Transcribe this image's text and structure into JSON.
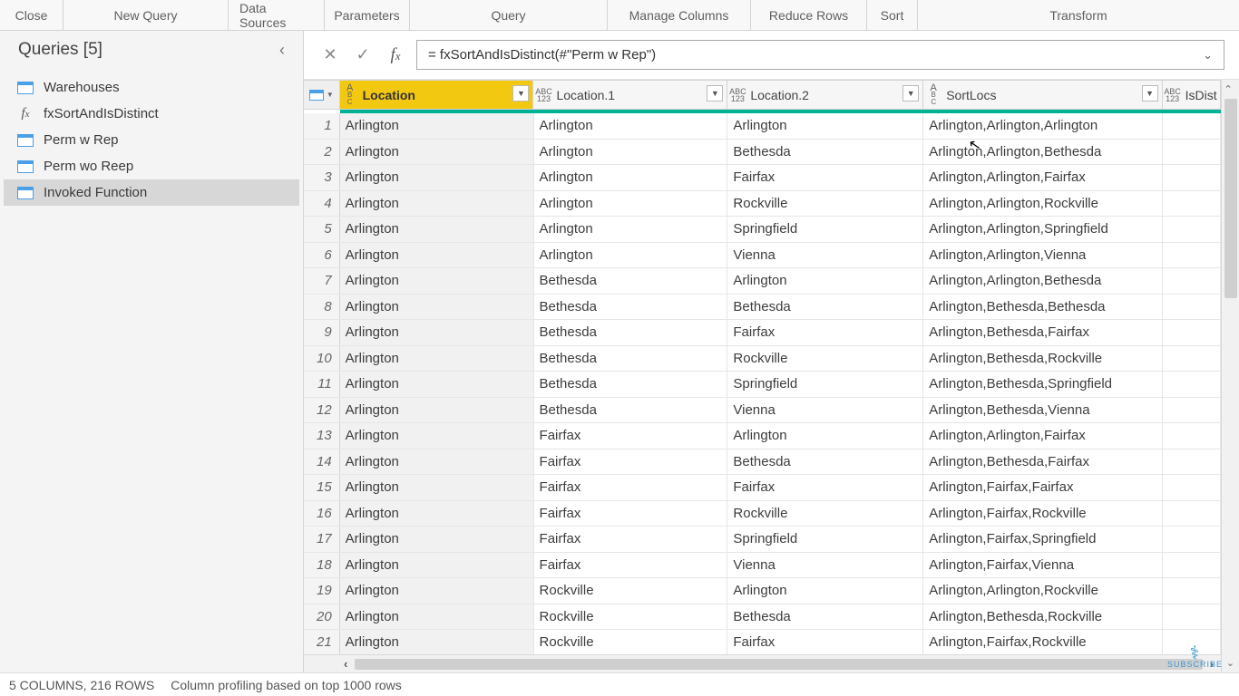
{
  "ribbon": {
    "close": "Close",
    "new_query": "New Query",
    "data_sources": "Data Sources",
    "parameters": "Parameters",
    "query": "Query",
    "manage_columns": "Manage Columns",
    "reduce_rows": "Reduce Rows",
    "sort": "Sort",
    "transform": "Transform"
  },
  "nav": {
    "title": "Queries [5]",
    "items": [
      {
        "label": "Warehouses",
        "type": "table"
      },
      {
        "label": "fxSortAndIsDistinct",
        "type": "fx"
      },
      {
        "label": "Perm w Rep",
        "type": "table"
      },
      {
        "label": "Perm wo Reep",
        "type": "table"
      },
      {
        "label": "Invoked Function",
        "type": "table"
      }
    ]
  },
  "formula": "= fxSortAndIsDistinct(#\"Perm w Rep\")",
  "columns": [
    {
      "name": "Location",
      "type": "ABC"
    },
    {
      "name": "Location.1",
      "type": "ABC123"
    },
    {
      "name": "Location.2",
      "type": "ABC123"
    },
    {
      "name": "SortLocs",
      "type": "ABC"
    },
    {
      "name": "IsDist",
      "type": "ABC123"
    }
  ],
  "rows": [
    [
      "Arlington",
      "Arlington",
      "Arlington",
      "Arlington,Arlington,Arlington"
    ],
    [
      "Arlington",
      "Arlington",
      "Bethesda",
      "Arlington,Arlington,Bethesda"
    ],
    [
      "Arlington",
      "Arlington",
      "Fairfax",
      "Arlington,Arlington,Fairfax"
    ],
    [
      "Arlington",
      "Arlington",
      "Rockville",
      "Arlington,Arlington,Rockville"
    ],
    [
      "Arlington",
      "Arlington",
      "Springfield",
      "Arlington,Arlington,Springfield"
    ],
    [
      "Arlington",
      "Arlington",
      "Vienna",
      "Arlington,Arlington,Vienna"
    ],
    [
      "Arlington",
      "Bethesda",
      "Arlington",
      "Arlington,Arlington,Bethesda"
    ],
    [
      "Arlington",
      "Bethesda",
      "Bethesda",
      "Arlington,Bethesda,Bethesda"
    ],
    [
      "Arlington",
      "Bethesda",
      "Fairfax",
      "Arlington,Bethesda,Fairfax"
    ],
    [
      "Arlington",
      "Bethesda",
      "Rockville",
      "Arlington,Bethesda,Rockville"
    ],
    [
      "Arlington",
      "Bethesda",
      "Springfield",
      "Arlington,Bethesda,Springfield"
    ],
    [
      "Arlington",
      "Bethesda",
      "Vienna",
      "Arlington,Bethesda,Vienna"
    ],
    [
      "Arlington",
      "Fairfax",
      "Arlington",
      "Arlington,Arlington,Fairfax"
    ],
    [
      "Arlington",
      "Fairfax",
      "Bethesda",
      "Arlington,Bethesda,Fairfax"
    ],
    [
      "Arlington",
      "Fairfax",
      "Fairfax",
      "Arlington,Fairfax,Fairfax"
    ],
    [
      "Arlington",
      "Fairfax",
      "Rockville",
      "Arlington,Fairfax,Rockville"
    ],
    [
      "Arlington",
      "Fairfax",
      "Springfield",
      "Arlington,Fairfax,Springfield"
    ],
    [
      "Arlington",
      "Fairfax",
      "Vienna",
      "Arlington,Fairfax,Vienna"
    ],
    [
      "Arlington",
      "Rockville",
      "Arlington",
      "Arlington,Arlington,Rockville"
    ],
    [
      "Arlington",
      "Rockville",
      "Bethesda",
      "Arlington,Bethesda,Rockville"
    ],
    [
      "Arlington",
      "Rockville",
      "Fairfax",
      "Arlington,Fairfax,Rockville"
    ]
  ],
  "status": {
    "cols_rows": "5 COLUMNS, 216 ROWS",
    "profiling": "Column profiling based on top 1000 rows"
  },
  "subscribe": "SUBSCRIBE"
}
